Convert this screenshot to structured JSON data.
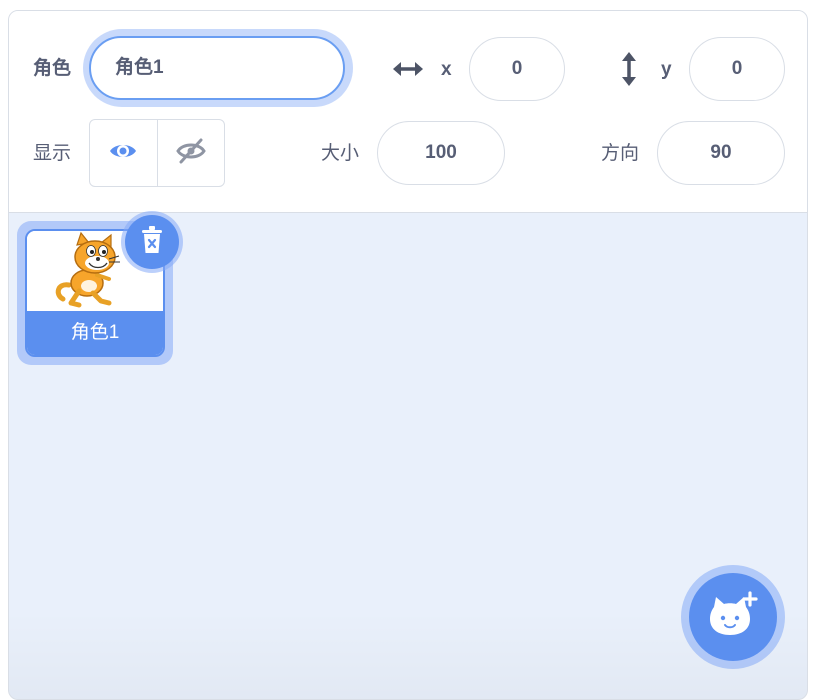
{
  "sprite_info": {
    "sprite_label": "角色",
    "sprite_name_value": "角色1",
    "x_label": "x",
    "x_value": "0",
    "y_label": "y",
    "y_value": "0",
    "show_label": "显示",
    "visible": true,
    "size_label": "大小",
    "size_value": "100",
    "direction_label": "方向",
    "direction_value": "90"
  },
  "sprite_list": {
    "items": [
      {
        "name": "角色1",
        "selected": true
      }
    ]
  },
  "colors": {
    "accent": "#5b8fef",
    "text": "#575e75",
    "border": "#d9dee6",
    "panel_bg": "#e9f0fb"
  },
  "icons": {
    "x_axis": "horizontal-arrows-icon",
    "y_axis": "vertical-arrows-icon",
    "show": "eye-icon",
    "hide": "eye-slash-icon",
    "delete": "trash-icon",
    "add": "cat-plus-icon",
    "sprite_costume": "scratch-cat"
  }
}
